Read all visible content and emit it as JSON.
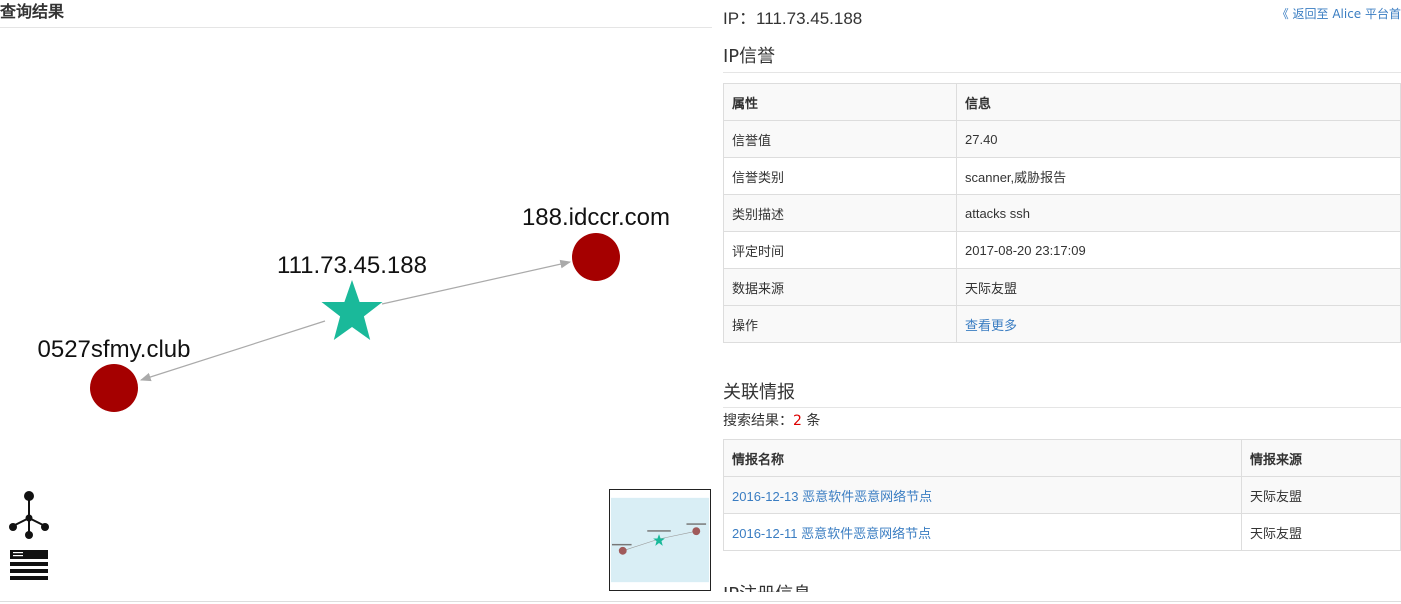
{
  "left": {
    "header": "查询结果",
    "nodes": {
      "center": "111.73.45.188",
      "right": "188.idccr.com",
      "left": "0527sfmy.club"
    },
    "colors": {
      "center": "#1ab99a",
      "domain": "#a50000",
      "edge": "#aaaaaa",
      "minimap_bg": "#d9eef5"
    }
  },
  "right": {
    "ip_title": "IP：111.73.45.188",
    "back_link": "《 返回至 Alice 平台首",
    "reputation": {
      "title": "IP信誉",
      "headers": [
        "属性",
        "信息"
      ],
      "rows": [
        [
          "信誉值",
          "27.40"
        ],
        [
          "信誉类别",
          "scanner,威胁报告"
        ],
        [
          "类别描述",
          "attacks ssh"
        ],
        [
          "评定时间",
          "2017-08-20 23:17:09"
        ],
        [
          "数据来源",
          "天际友盟"
        ],
        [
          "操作",
          "查看更多"
        ]
      ]
    },
    "related": {
      "title": "关联情报",
      "search_prefix": "搜索结果：",
      "search_count": "2",
      "search_suffix": " 条",
      "headers": [
        "情报名称",
        "情报来源"
      ],
      "rows": [
        [
          "2016-12-13 恶意软件恶意网络节点",
          "天际友盟"
        ],
        [
          "2016-12-11 恶意软件恶意网络节点",
          "天际友盟"
        ]
      ]
    },
    "next_section_title": "IP注册信息"
  }
}
